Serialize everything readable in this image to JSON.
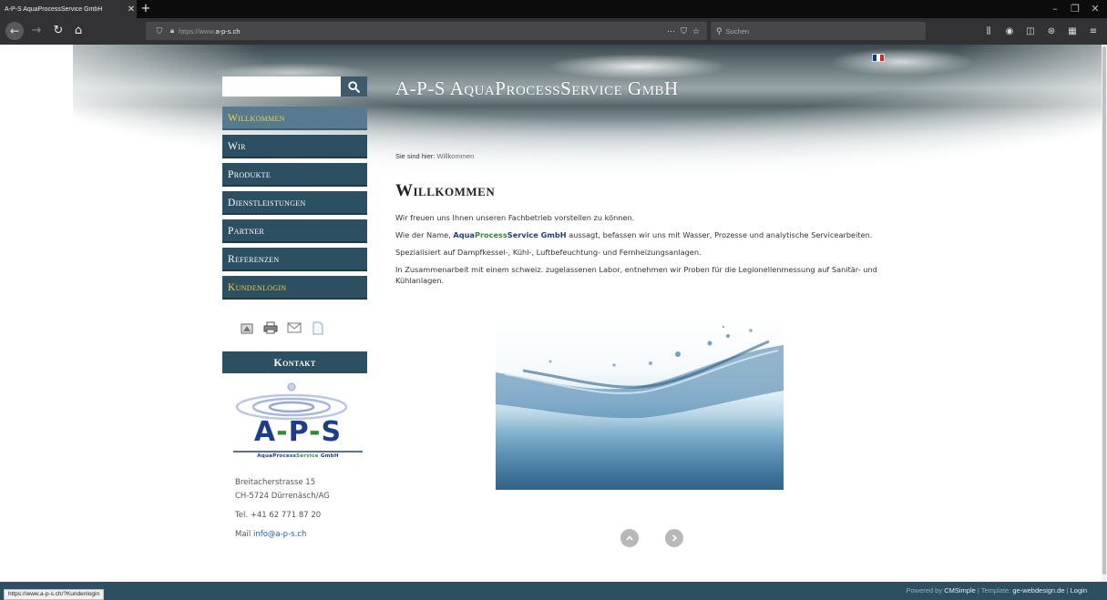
{
  "browser": {
    "tab_title": "A-P-S AquaProcessService GmbH",
    "tab_close": "✕",
    "new_tab": "+",
    "url_prefix": "https://www.",
    "url_host": "a-p-s.ch",
    "search_placeholder": "Suchen",
    "status_url": "https://www.a-p-s.ch/?Kundenlogin"
  },
  "site": {
    "title": "A-P-S AquaProcessService GmbH",
    "search_value": ""
  },
  "menu": {
    "items": [
      {
        "label": "Willkommen"
      },
      {
        "label": "Wir"
      },
      {
        "label": "Produkte"
      },
      {
        "label": "Dienstleistungen"
      },
      {
        "label": "Partner"
      },
      {
        "label": "Referenzen"
      },
      {
        "label": "Kundenlogin"
      }
    ]
  },
  "sidebar": {
    "contact_heading": "Kontakt",
    "logo_text_a": "A",
    "logo_text_dash1": "-",
    "logo_text_p": "P",
    "logo_text_dash2": "-",
    "logo_text_s": "S",
    "logo_sub_a": "AquaProcess",
    "logo_sub_b": "Service",
    "logo_sub_c": " GmbH",
    "address_street": "Breitacherstrasse 15",
    "address_city": "CH-5724 Dürrenäsch/AG",
    "phone": "Tel. +41 62 771 87 20",
    "mail_label": "Mail ",
    "mail": "info@a-p-s.ch"
  },
  "breadcrumb": {
    "label": "Sie sind hier:",
    "current": "Willkommen"
  },
  "content": {
    "heading": "Willkommen",
    "p1": "Wir freuen uns Ihnen unseren Fachbetrieb vorstellen zu können.",
    "p2_before": "Wie der Name, ",
    "p2_brand_a": "Aqua",
    "p2_brand_b": "Process",
    "p2_brand_c": "Service GmbH",
    "p2_after": " aussagt, befassen wir uns mit Wasser, Prozesse und analytische Servicearbeiten.",
    "p3": "Spezialisiert auf Dampfkessel-, Kühl-, Luftbefeuchtung- und Fernheizungsanlagen.",
    "p4": "In Zusammenarbeit mit einem schweiz. zugelassenen Labor, entnehmen wir Proben für die Legionellenmessung auf Sanitär- und Kühlanlagen."
  },
  "footer": {
    "powered_by": "Powered by ",
    "cms": "CMSimple",
    "sep1": " | Template: ",
    "template": "ge-webdesign.de",
    "sep2": " | ",
    "login": "Login"
  },
  "colors": {
    "menu_bg": "#2d4f62",
    "menu_active_bg": "#577a8e",
    "menu_active_text": "#f2cf3d",
    "brand_blue": "#1e3d8c",
    "brand_green": "#2e8b3a"
  }
}
